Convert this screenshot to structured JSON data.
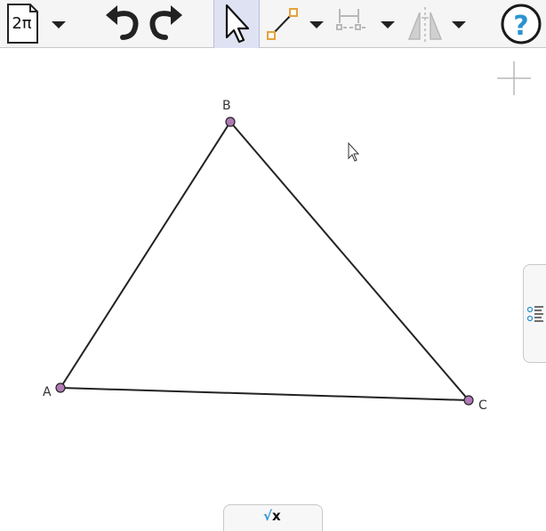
{
  "toolbar": {
    "document_icon_label": "2π",
    "tools": [
      {
        "name": "new-document",
        "icon": "document-icon"
      },
      {
        "name": "undo",
        "icon": "undo-icon"
      },
      {
        "name": "redo",
        "icon": "redo-icon"
      },
      {
        "name": "select",
        "icon": "arrow-cursor-icon",
        "active": true
      },
      {
        "name": "segment",
        "icon": "segment-icon"
      },
      {
        "name": "measure",
        "icon": "measure-icon",
        "disabled": true
      },
      {
        "name": "reflect",
        "icon": "reflect-icon",
        "disabled": true
      },
      {
        "name": "help",
        "icon": "help-icon"
      }
    ]
  },
  "canvas": {
    "points": [
      {
        "label": "A"
      },
      {
        "label": "B"
      },
      {
        "label": "C"
      }
    ],
    "point_color": "#b07ab5",
    "line_color": "#222222"
  },
  "formula_tab": {
    "root_symbol": "√",
    "variable": "x"
  },
  "colors": {
    "accent_blue": "#2c93d3",
    "segment_orange": "#e6a23c",
    "active_tool_bg": "#dfe2f2"
  }
}
